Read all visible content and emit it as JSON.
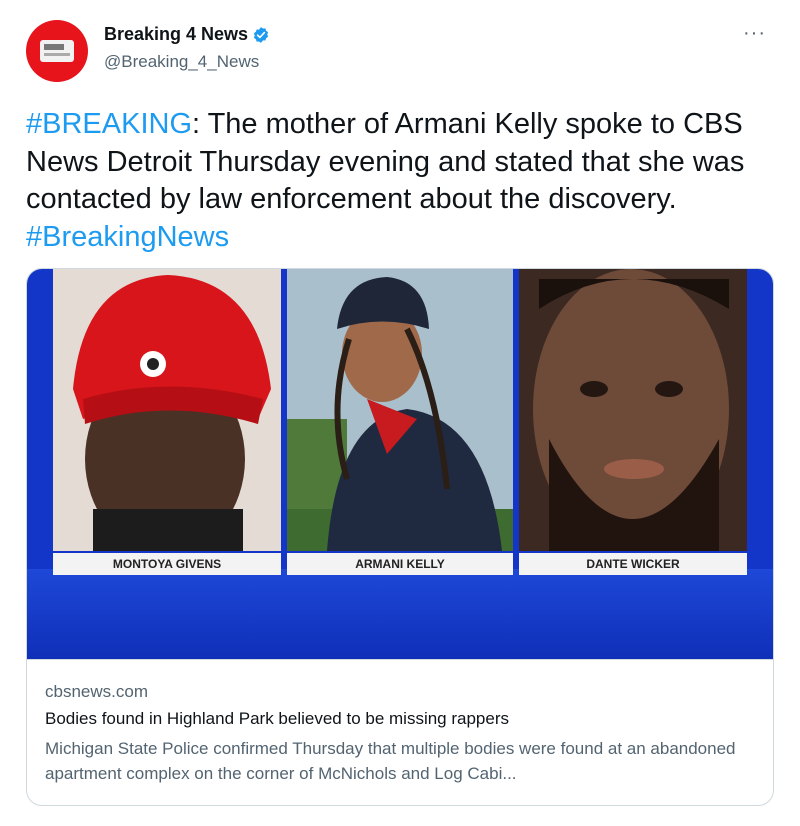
{
  "author": {
    "display_name": "Breaking 4 News",
    "handle": "@Breaking_4_News",
    "verified_icon": "verified-badge-icon",
    "avatar_icon": "tv-icon"
  },
  "more_label": "···",
  "tweet": {
    "hashtag_breaking": "#BREAKING",
    "text_main": ": The mother of Armani Kelly spoke to CBS News Detroit Thursday evening and stated that she was contacted by law enforcement about the discovery. ",
    "hashtag_news": "#BreakingNews"
  },
  "card": {
    "nameplates": [
      "MONTOYA GIVENS",
      "ARMANI KELLY",
      "DANTE WICKER"
    ],
    "domain": "cbsnews.com",
    "title": "Bodies found in Highland Park believed to be missing rappers",
    "description": "Michigan State Police confirmed Thursday that multiple bodies were found at an abandoned apartment complex on the corner of McNichols and Log Cabi...",
    "media_color": "#1436c8"
  },
  "colors": {
    "link": "#1d9bf0",
    "avatar_bg": "#e8141c",
    "secondary_text": "#536471"
  }
}
